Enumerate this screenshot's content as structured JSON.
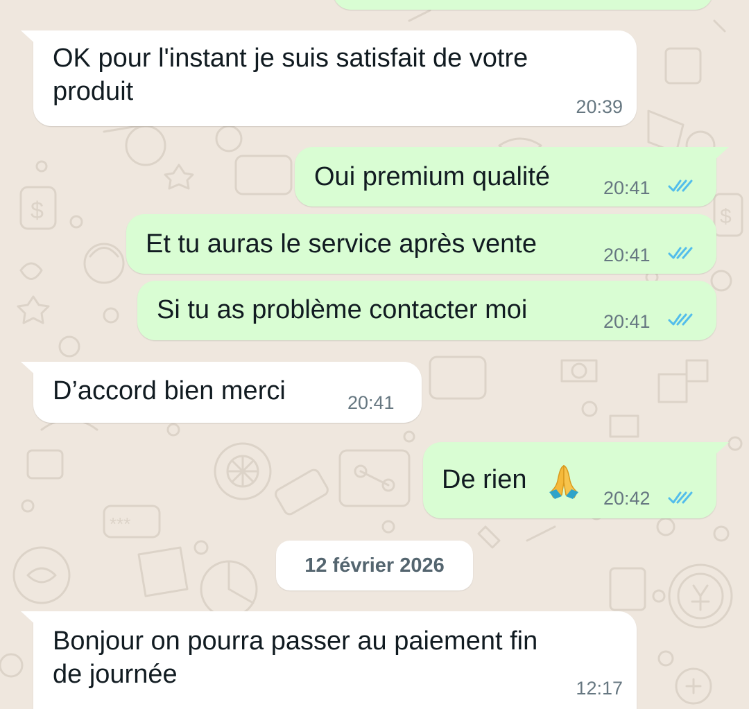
{
  "messages": [
    {
      "direction": "incoming",
      "text_lines": [
        "OK pour l'instant je suis satisfait de votre",
        "produit"
      ],
      "time": "20:39"
    },
    {
      "direction": "outgoing",
      "text": "Oui premium qualité",
      "time": "20:41",
      "status": "read"
    },
    {
      "direction": "outgoing",
      "text": "Et tu auras le service après vente",
      "time": "20:41",
      "status": "read"
    },
    {
      "direction": "outgoing",
      "text": "Si tu as problème contacter moi",
      "time": "20:41",
      "status": "read"
    },
    {
      "direction": "incoming",
      "text": "D’accord bien merci",
      "time": "20:41"
    },
    {
      "direction": "outgoing",
      "text": "De rien",
      "emoji": "folded-hands",
      "time": "20:42",
      "status": "read"
    },
    {
      "direction": "incoming",
      "text_lines": [
        "Bonjour on pourra passer au paiement fin",
        "de journée"
      ],
      "time": "12:17"
    }
  ],
  "date_separator": "12 février 2026",
  "colors": {
    "wallpaper": "#EFE7DE",
    "incoming_bubble": "#FFFFFF",
    "outgoing_bubble": "#D9FDD3",
    "read_ticks": "#53BDEB",
    "timestamp": "#667781",
    "message_text": "#111B21"
  }
}
